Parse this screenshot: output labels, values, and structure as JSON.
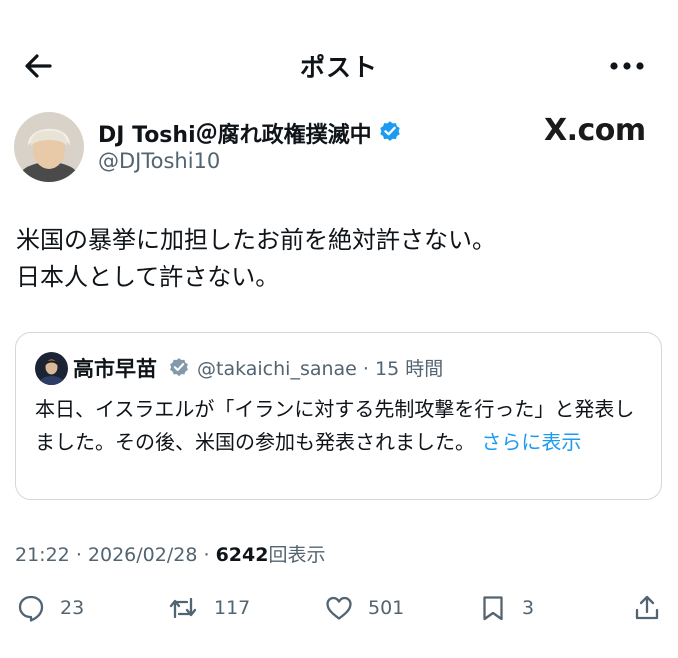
{
  "header": {
    "title": "ポスト"
  },
  "post": {
    "author_name": "DJ Toshi＠腐れ政権撲滅中",
    "handle": "@DJToshi10",
    "brand": "X.com",
    "text_line1": "米国の暴挙に加担したお前を絶対許さない。",
    "text_line2": "日本人として許さない。"
  },
  "quote": {
    "author_name": "高市早苗",
    "handle": "@takaichi_sanae",
    "separator": "·",
    "time_ago": "15 時間",
    "text": "本日、イスラエルが「イランに対する先制攻撃を行った」と発表しました。その後、米国の参加も発表されました。",
    "show_more": "さらに表示"
  },
  "meta": {
    "time": "21:22",
    "separator": "·",
    "date": "2026/02/28",
    "views_count": "6242",
    "views_label": "回表示"
  },
  "actions": {
    "replies": "23",
    "reposts": "117",
    "likes": "501",
    "bookmarks": "3"
  },
  "colors": {
    "accent": "#1d9bf0",
    "secondary_text": "#536471",
    "primary_text": "#0f1419",
    "border": "#cfd9de"
  }
}
